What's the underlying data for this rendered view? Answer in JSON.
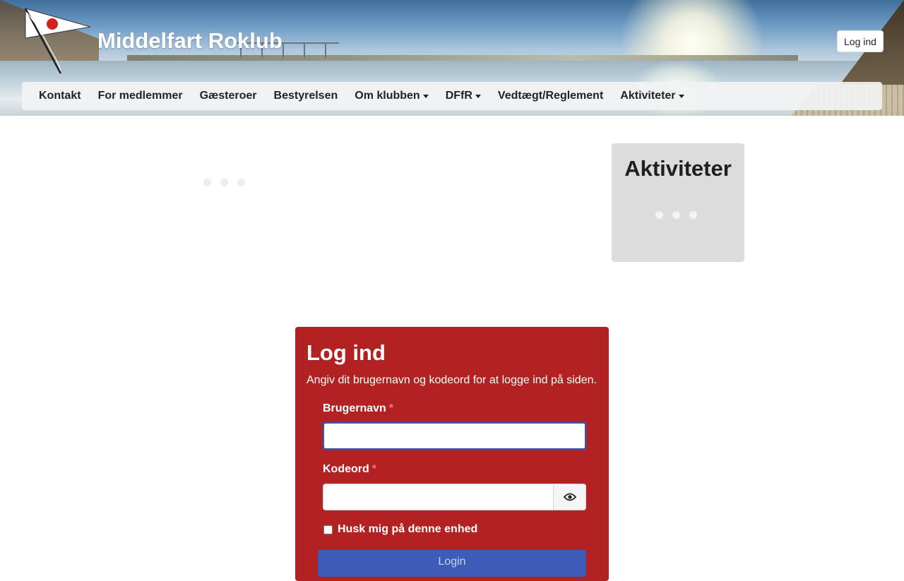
{
  "header": {
    "site_title": "Middelfart Roklub",
    "login_button": "Log ind"
  },
  "nav": {
    "items": [
      {
        "label": "Kontakt",
        "dropdown": false
      },
      {
        "label": "For medlemmer",
        "dropdown": false
      },
      {
        "label": "Gæsteroer",
        "dropdown": false
      },
      {
        "label": "Bestyrelsen",
        "dropdown": false
      },
      {
        "label": "Om klubben",
        "dropdown": true
      },
      {
        "label": "DFfR",
        "dropdown": true
      },
      {
        "label": "Vedtægt/Reglement",
        "dropdown": false
      },
      {
        "label": "Aktiviteter",
        "dropdown": true
      }
    ]
  },
  "sidebar": {
    "title": "Aktiviteter"
  },
  "login_card": {
    "title": "Log ind",
    "description": "Angiv dit brugernavn og kodeord for at logge ind på siden.",
    "username_label": "Brugernavn",
    "username_value": "",
    "password_label": "Kodeord",
    "password_value": "",
    "required_marker": "*",
    "remember_label": "Husk mig på denne enhed",
    "remember_checked": false,
    "submit_label": "Login"
  },
  "icons": {
    "logo": "club-pennant-logo",
    "password_toggle": "eye-icon"
  },
  "colors": {
    "card_background": "#b22222",
    "submit_button": "#3d5cb8",
    "focus_border": "#3d51b0",
    "sidebar_panel": "#dcdcdc"
  }
}
